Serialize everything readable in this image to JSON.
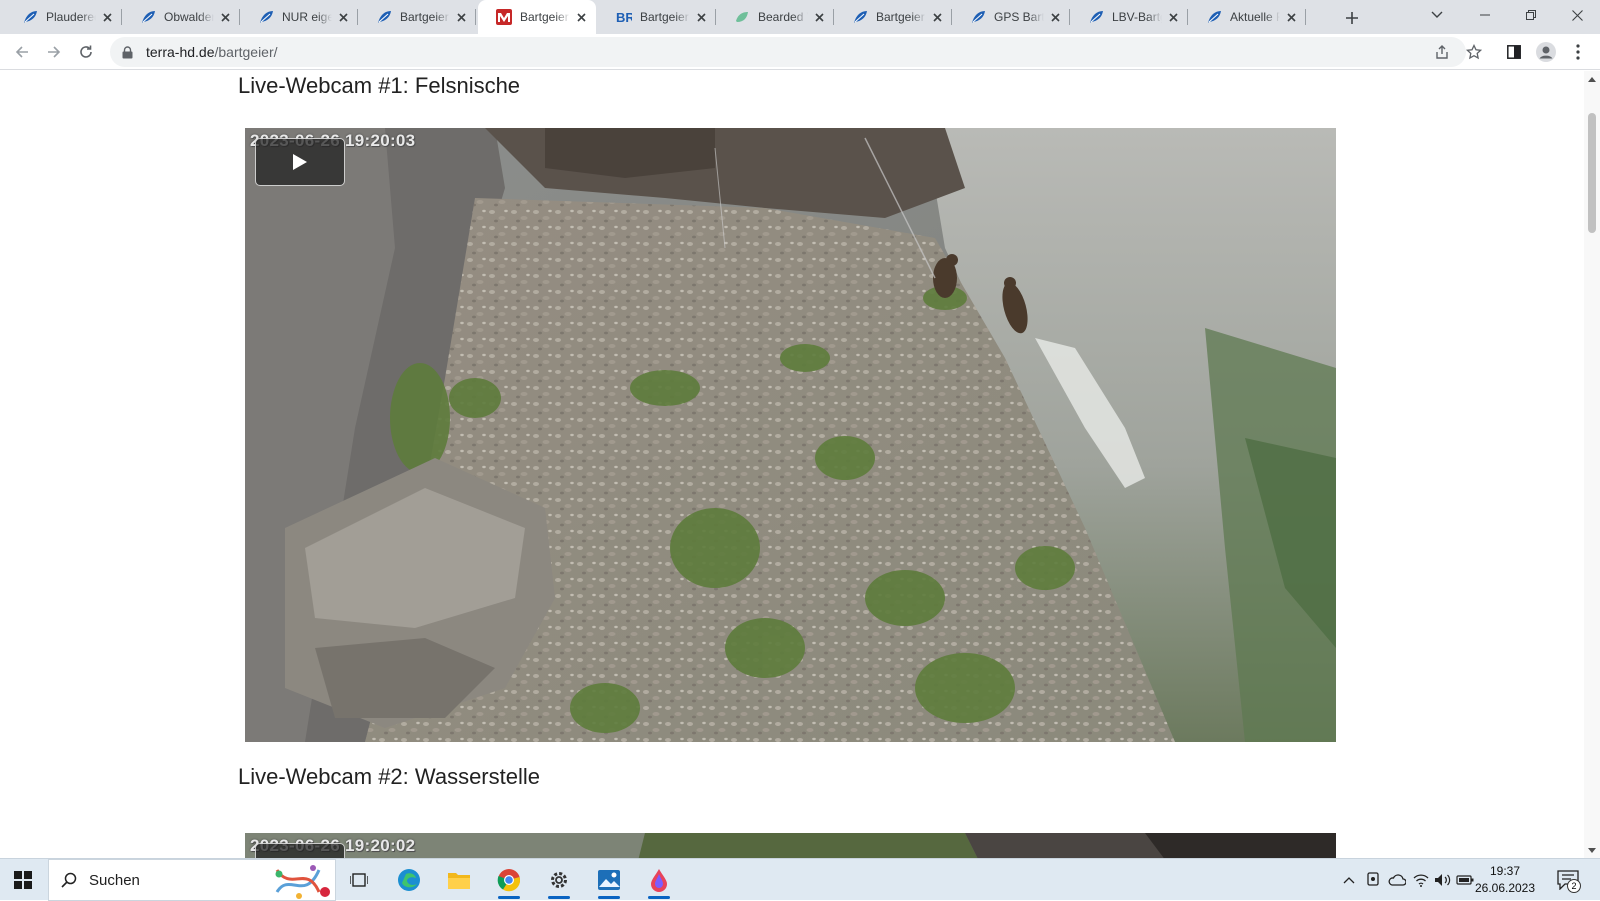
{
  "browser": {
    "tabs": [
      {
        "title": "Plauderecke",
        "icon": "feather-icon",
        "active": false
      },
      {
        "title": "Obwaldera",
        "icon": "feather-icon",
        "active": false
      },
      {
        "title": "NUR eigene",
        "icon": "feather-icon",
        "active": false
      },
      {
        "title": "Bartgeier W",
        "icon": "feather-icon",
        "active": false
      },
      {
        "title": "Bartgeier W",
        "icon": "red-m-logo-icon",
        "active": true
      },
      {
        "title": "Bartgeier R",
        "icon": "br-logo-icon",
        "active": false
      },
      {
        "title": "Bearded V",
        "icon": "leaf-icon",
        "active": false
      },
      {
        "title": "Bartgeier a",
        "icon": "feather-icon",
        "active": false
      },
      {
        "title": "GPS Bartge",
        "icon": "feather-icon",
        "active": false
      },
      {
        "title": "LBV-Bartge",
        "icon": "feather-icon",
        "active": false
      },
      {
        "title": "Aktuelle Fo",
        "icon": "feather-icon",
        "active": false
      }
    ],
    "url_domain": "terra-hd.de",
    "url_path": "/bartgeier/"
  },
  "page": {
    "webcam1": {
      "heading": "Live-Webcam #1: Felsnische",
      "timestamp": "2023-06-26 19:20:03"
    },
    "webcam2": {
      "heading": "Live-Webcam #2: Wasserstelle",
      "timestamp": "2023-06-26 19:20:02"
    }
  },
  "taskbar": {
    "search_placeholder": "Suchen",
    "time": "19:37",
    "date": "26.06.2023",
    "notification_count": "2"
  },
  "colors": {
    "tabstrip": "#dee1e6",
    "taskbar": "#dfe9f2",
    "accent": "#0a64c2"
  }
}
